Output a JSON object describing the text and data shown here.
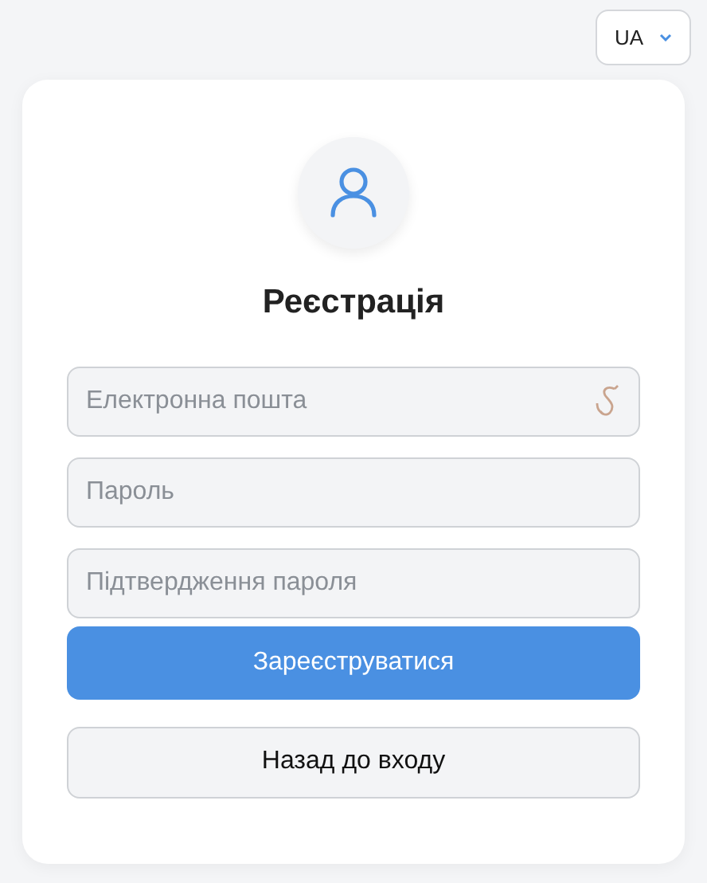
{
  "language": {
    "value": "UA"
  },
  "title": "Реєстрація",
  "fields": [
    {
      "placeholder": "Електронна пошта",
      "kind": "email"
    },
    {
      "placeholder": "Пароль",
      "kind": "password"
    },
    {
      "placeholder": "Підтвердження пароля",
      "kind": "password"
    }
  ],
  "buttons": [
    {
      "label": "Зареєструватися",
      "kind": "primary"
    },
    {
      "label": "Назад до входу",
      "kind": "secondary"
    }
  ]
}
